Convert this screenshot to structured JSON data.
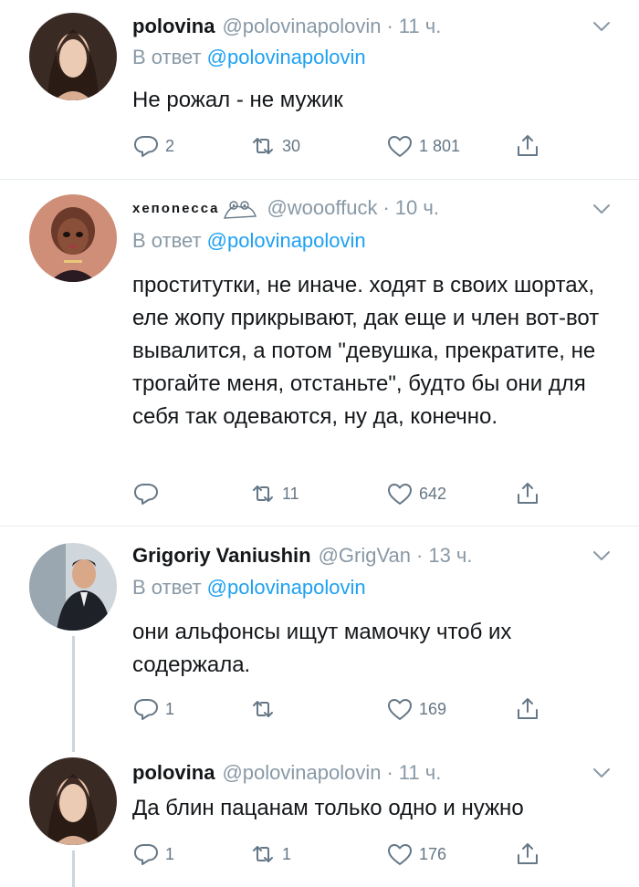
{
  "tweets": [
    {
      "name": "polovina",
      "handle": "@polovinapolovin",
      "time": "11 ч.",
      "reply_label": "В ответ",
      "reply_handle": "@polovinapolovin",
      "text": "Не рожал - не мужик",
      "replies": "2",
      "retweets": "30",
      "likes": "1 801"
    },
    {
      "name": "xeпonecca",
      "handle": "@woooffuck",
      "time": "10 ч.",
      "reply_label": "В ответ",
      "reply_handle": "@polovinapolovin",
      "text": "проститутки, не иначе. ходят в своих шортах, еле жопу прикрывают, дак еще и член вот-вот вывалится, а потом \"девушка, прекратите, не трогайте меня, отстаньте\", будто бы они для себя так одеваются, ну да, конечно.",
      "replies": "",
      "retweets": "11",
      "likes": "642"
    },
    {
      "name": "Grigoriy Vaniushin",
      "handle": "@GrigVan",
      "time": "13 ч.",
      "reply_label": "В ответ",
      "reply_handle": "@polovinapolovin",
      "text": "они альфонсы ищут мамочку чтоб их содержала.",
      "replies": "1",
      "retweets": "",
      "likes": "169"
    },
    {
      "name": "polovina",
      "handle": "@polovinapolovin",
      "time": "11 ч.",
      "text": "Да блин пацанам только одно и нужно",
      "replies": "1",
      "retweets": "1",
      "likes": "176"
    }
  ],
  "separator": "·",
  "colors": {
    "accent": "#1da1f2",
    "muted": "#8899a6",
    "divider": "#e6ecf0",
    "text": "#14171a"
  },
  "icons": {
    "reply": "reply-icon",
    "retweet": "retweet-icon",
    "like": "heart-icon",
    "share": "share-icon",
    "menu": "chevron-down-icon"
  }
}
